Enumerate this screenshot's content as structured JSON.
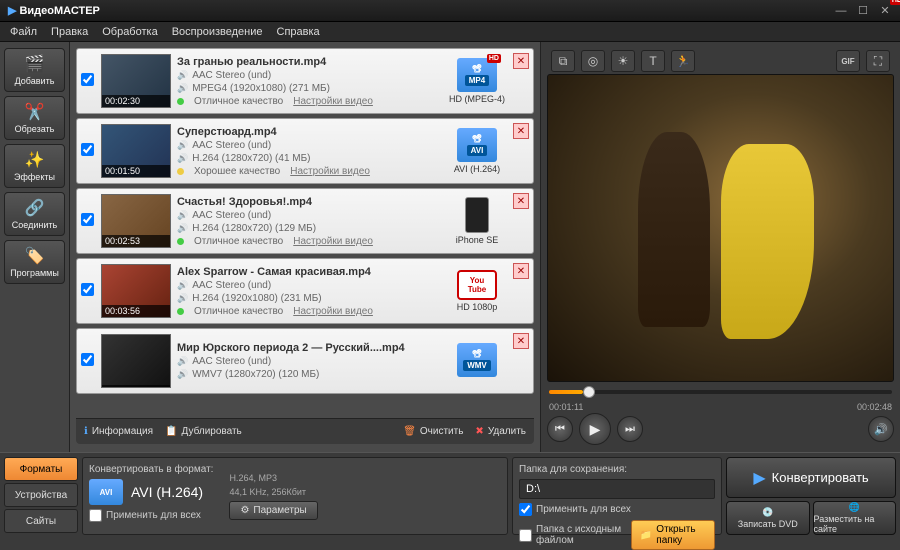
{
  "app": {
    "title": "ВидеоМАСТЕР"
  },
  "menu": [
    "Файл",
    "Правка",
    "Обработка",
    "Воспроизведение",
    "Справка"
  ],
  "sidebar": [
    {
      "label": "Добавить",
      "icon": "add-video"
    },
    {
      "label": "Обрезать",
      "icon": "crop"
    },
    {
      "label": "Эффекты",
      "icon": "effects"
    },
    {
      "label": "Соединить",
      "icon": "join"
    },
    {
      "label": "Программы",
      "icon": "programs"
    }
  ],
  "files": [
    {
      "name": "За гранью реальности.mp4",
      "audio": "AAC Stereo (und)",
      "video": "MPEG4 (1920x1080) (271 МБ)",
      "quality": "Отличное качество",
      "qcolor": "green",
      "settings": "Настройки видео",
      "duration": "00:02:30",
      "target": "MP4",
      "targetDetail": "HD (MPEG-4)",
      "hd": true,
      "fmt": "mp4"
    },
    {
      "name": "Суперстюард.mp4",
      "audio": "AAC Stereo (und)",
      "video": "H.264 (1280x720) (41 МБ)",
      "quality": "Хорошее качество",
      "qcolor": "yellow",
      "settings": "Настройки видео",
      "duration": "00:01:50",
      "target": "AVI",
      "targetDetail": "AVI (H.264)",
      "hd": false,
      "fmt": "avi"
    },
    {
      "name": "Счастья! Здоровья!.mp4",
      "audio": "AAC Stereo (und)",
      "video": "H.264 (1280x720) (129 МБ)",
      "quality": "Отличное качество",
      "qcolor": "green",
      "settings": "Настройки видео",
      "duration": "00:02:53",
      "target": "iPhone SE",
      "targetDetail": "iPhone SE",
      "hd": false,
      "fmt": "iphone"
    },
    {
      "name": "Alex Sparrow - Самая красивая.mp4",
      "audio": "AAC Stereo (und)",
      "video": "H.264 (1920x1080) (231 МБ)",
      "quality": "Отличное качество",
      "qcolor": "green",
      "settings": "Настройки видео",
      "duration": "00:03:56",
      "target": "YouTube",
      "targetDetail": "HD 1080p",
      "hd": true,
      "fmt": "youtube"
    },
    {
      "name": "Мир Юрского периода 2 — Русский....mp4",
      "audio": "AAC Stereo (und)",
      "video": "WMV7 (1280x720) (120 МБ)",
      "quality": "",
      "qcolor": "",
      "settings": "",
      "duration": "",
      "target": "WMV",
      "targetDetail": "",
      "hd": false,
      "fmt": "wmv"
    }
  ],
  "listbar": {
    "info": "Информация",
    "dup": "Дублировать",
    "clear": "Очистить",
    "del": "Удалить"
  },
  "preview": {
    "current": "00:01:11",
    "total": "00:02:48",
    "gif": "GIF"
  },
  "fmtTabs": [
    "Форматы",
    "Устройства",
    "Сайты"
  ],
  "convert": {
    "label": "Конвертировать в формат:",
    "fmtIcon": "AVI",
    "fmtName": "AVI (H.264)",
    "specs1": "H.264, MP3",
    "specs2": "44,1 KHz, 256Кбит",
    "applyAll": "Применить для всех",
    "params": "Параметры"
  },
  "save": {
    "label": "Папка для сохранения:",
    "path": "D:\\",
    "applyAll": "Применить для всех",
    "srcFolder": "Папка с исходным файлом",
    "open": "Открыть папку"
  },
  "actions": {
    "convert": "Конвертировать",
    "dvd": "Записать DVD",
    "dvdIcon": "💿",
    "upload": "Разместить на сайте",
    "uploadIcon": "🌐"
  }
}
